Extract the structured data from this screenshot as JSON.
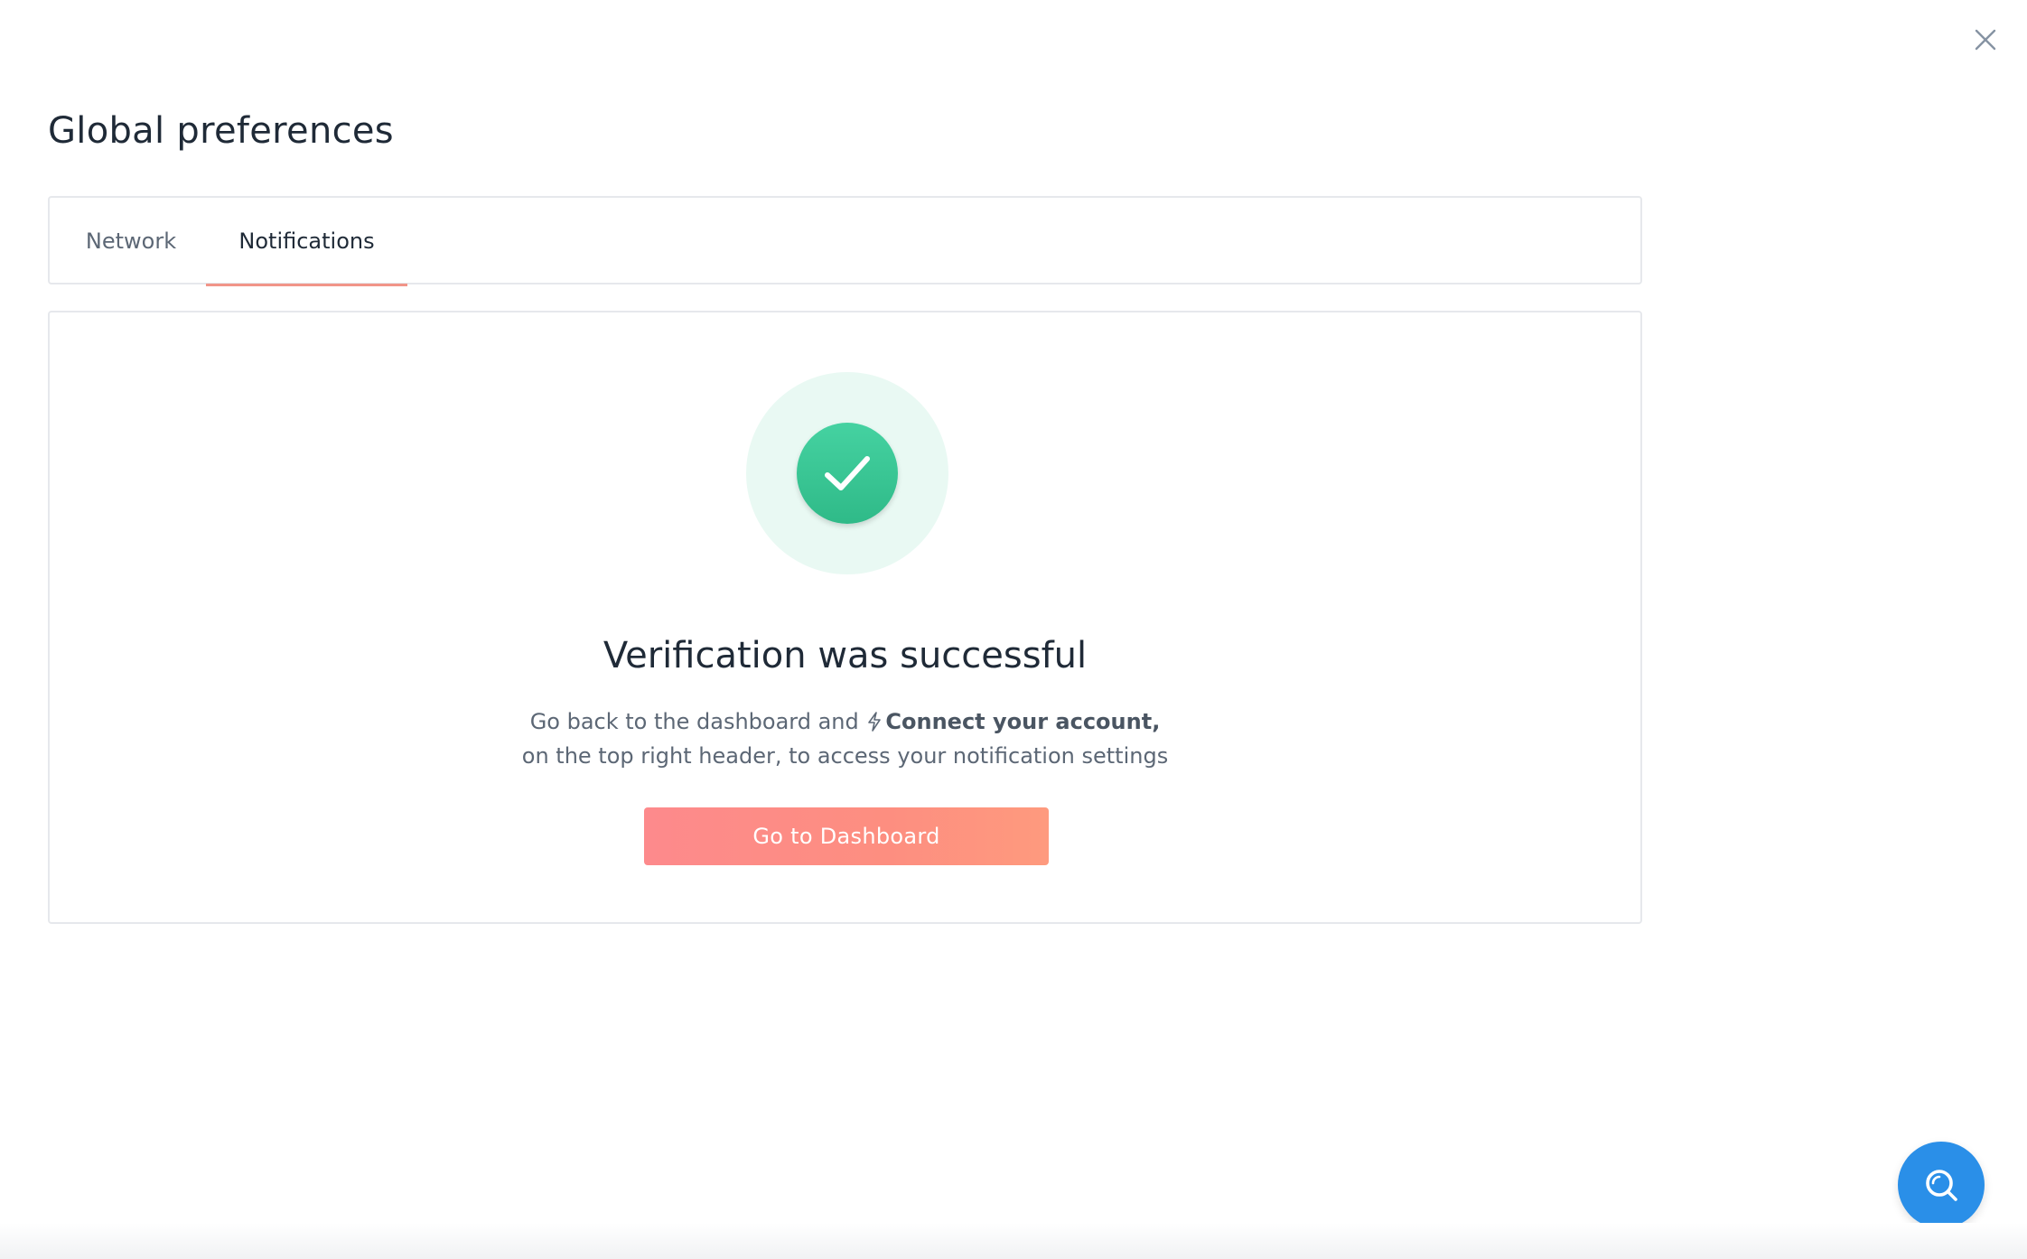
{
  "header": {
    "title": "Global preferences",
    "close_icon": "close-icon"
  },
  "tabs": [
    {
      "label": "Network",
      "active": false
    },
    {
      "label": "Notifications",
      "active": true
    }
  ],
  "verification": {
    "status_icon": "checkmark-icon",
    "title": "Verification was successful",
    "desc_prefix": "Go back to the dashboard and",
    "connect_icon": "bolt-icon",
    "connect_label": "Connect your account,",
    "desc_line2": "on the top right header, to access your notification settings",
    "button_label": "Go to Dashboard"
  },
  "help": {
    "icon": "help-search-icon"
  },
  "colors": {
    "accent_tab": "#f19589",
    "success_green": "#3cc696",
    "success_halo": "#e9f9f3",
    "button_gradient_start": "#fd8a8c",
    "button_gradient_end": "#fe9a7e",
    "help_blue": "#2a8fe8"
  }
}
